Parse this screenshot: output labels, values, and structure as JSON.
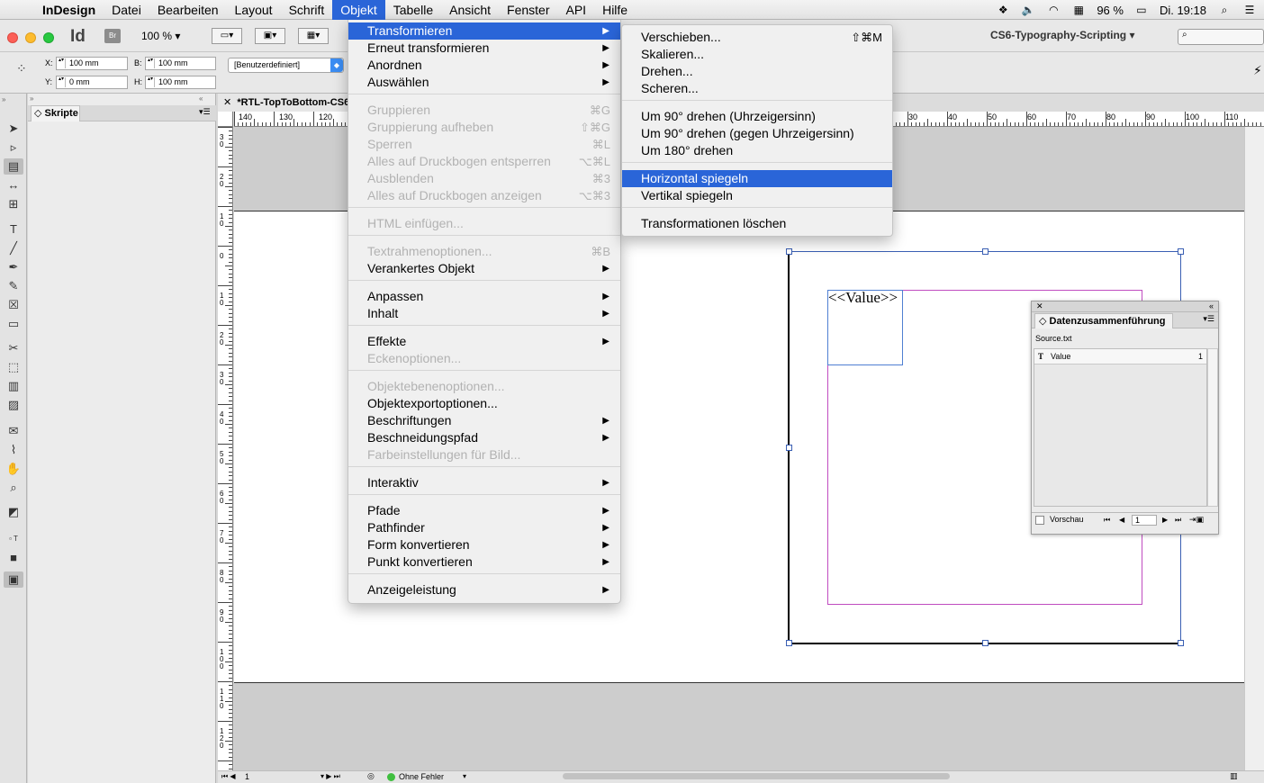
{
  "menubar": {
    "apple_symbol": "",
    "app_name": "InDesign",
    "items": [
      "Datei",
      "Bearbeiten",
      "Layout",
      "Schrift",
      "Objekt",
      "Tabelle",
      "Ansicht",
      "Fenster",
      "API",
      "Hilfe"
    ],
    "active_item": "Objekt",
    "status": {
      "battery": "96 %",
      "clock": "Di. 19:18"
    }
  },
  "control_bar": {
    "app_logo": "Id",
    "bridge": "Br",
    "zoom": "100 %",
    "workspace": "CS6-Typography-Scripting",
    "x_label": "X:",
    "x_value": "100 mm",
    "y_label": "Y:",
    "y_value": "0 mm",
    "w_label": "B:",
    "w_value": "100 mm",
    "h_label": "H:",
    "h_value": "100 mm",
    "style_select": "[Benutzerdefiniert]"
  },
  "scripts_panel": {
    "tab_label": "Skripte"
  },
  "document": {
    "tab_title": "*RTL-TopToBottom-CS6",
    "top_ruler_labels": [
      "140",
      "130",
      "120",
      "30",
      "40",
      "50",
      "60",
      "70",
      "80",
      "90",
      "100",
      "110"
    ],
    "left_ruler_labels": [
      "30",
      "20",
      "10",
      "0",
      "10",
      "20",
      "30",
      "40",
      "50",
      "60",
      "70",
      "80",
      "90",
      "100",
      "110",
      "120"
    ],
    "placeholder_text": "<<Value>>",
    "status_page": "1",
    "status_preflight": "Ohne Fehler"
  },
  "objekt_menu": {
    "items": [
      {
        "label": "Transformieren",
        "shortcut": "",
        "submenu": true,
        "disabled": false,
        "highlight": true
      },
      {
        "label": "Erneut transformieren",
        "shortcut": "",
        "submenu": true,
        "disabled": false
      },
      {
        "label": "Anordnen",
        "shortcut": "",
        "submenu": true,
        "disabled": false
      },
      {
        "label": "Auswählen",
        "shortcut": "",
        "submenu": true,
        "disabled": false
      },
      {
        "label": "Gruppieren",
        "shortcut": "⌘G",
        "submenu": false,
        "disabled": true
      },
      {
        "label": "Gruppierung aufheben",
        "shortcut": "⇧⌘G",
        "submenu": false,
        "disabled": true
      },
      {
        "label": "Sperren",
        "shortcut": "⌘L",
        "submenu": false,
        "disabled": true
      },
      {
        "label": "Alles auf Druckbogen entsperren",
        "shortcut": "⌥⌘L",
        "submenu": false,
        "disabled": true
      },
      {
        "label": "Ausblenden",
        "shortcut": "⌘3",
        "submenu": false,
        "disabled": true
      },
      {
        "label": "Alles auf Druckbogen anzeigen",
        "shortcut": "⌥⌘3",
        "submenu": false,
        "disabled": true
      },
      {
        "label": "HTML einfügen...",
        "shortcut": "",
        "submenu": false,
        "disabled": true
      },
      {
        "label": "Textrahmenoptionen...",
        "shortcut": "⌘B",
        "submenu": false,
        "disabled": true
      },
      {
        "label": "Verankertes Objekt",
        "shortcut": "",
        "submenu": true,
        "disabled": false
      },
      {
        "label": "Anpassen",
        "shortcut": "",
        "submenu": true,
        "disabled": false
      },
      {
        "label": "Inhalt",
        "shortcut": "",
        "submenu": true,
        "disabled": false
      },
      {
        "label": "Effekte",
        "shortcut": "",
        "submenu": true,
        "disabled": false
      },
      {
        "label": "Eckenoptionen...",
        "shortcut": "",
        "submenu": false,
        "disabled": true
      },
      {
        "label": "Objektebenenoptionen...",
        "shortcut": "",
        "submenu": false,
        "disabled": true
      },
      {
        "label": "Objektexportoptionen...",
        "shortcut": "",
        "submenu": false,
        "disabled": false
      },
      {
        "label": "Beschriftungen",
        "shortcut": "",
        "submenu": true,
        "disabled": false
      },
      {
        "label": "Beschneidungspfad",
        "shortcut": "",
        "submenu": true,
        "disabled": false
      },
      {
        "label": "Farbeinstellungen für Bild...",
        "shortcut": "",
        "submenu": false,
        "disabled": true
      },
      {
        "label": "Interaktiv",
        "shortcut": "",
        "submenu": true,
        "disabled": false
      },
      {
        "label": "Pfade",
        "shortcut": "",
        "submenu": true,
        "disabled": false
      },
      {
        "label": "Pathfinder",
        "shortcut": "",
        "submenu": true,
        "disabled": false
      },
      {
        "label": "Form konvertieren",
        "shortcut": "",
        "submenu": true,
        "disabled": false
      },
      {
        "label": "Punkt konvertieren",
        "shortcut": "",
        "submenu": true,
        "disabled": false
      },
      {
        "label": "Anzeigeleistung",
        "shortcut": "",
        "submenu": true,
        "disabled": false
      }
    ]
  },
  "transform_submenu": {
    "items": [
      {
        "label": "Verschieben...",
        "shortcut": "⇧⌘M"
      },
      {
        "label": "Skalieren...",
        "shortcut": ""
      },
      {
        "label": "Drehen...",
        "shortcut": ""
      },
      {
        "label": "Scheren...",
        "shortcut": ""
      },
      {
        "label": "Um 90° drehen (Uhrzeigersinn)",
        "shortcut": ""
      },
      {
        "label": "Um 90° drehen (gegen Uhrzeigersinn)",
        "shortcut": ""
      },
      {
        "label": "Um 180° drehen",
        "shortcut": ""
      },
      {
        "label": "Horizontal spiegeln",
        "shortcut": "",
        "highlight": true
      },
      {
        "label": "Vertikal spiegeln",
        "shortcut": ""
      },
      {
        "label": "Transformationen löschen",
        "shortcut": ""
      }
    ]
  },
  "data_merge_panel": {
    "title": "Datenzusammenführung",
    "source": "Source.txt",
    "fields": [
      {
        "name": "Value",
        "count": "1"
      }
    ],
    "preview_label": "Vorschau",
    "record": "1"
  },
  "colors": {
    "menu_highlight": "#2a65d8",
    "frame_blue": "#3a5fb3",
    "margin_magenta": "#c04cc0"
  }
}
